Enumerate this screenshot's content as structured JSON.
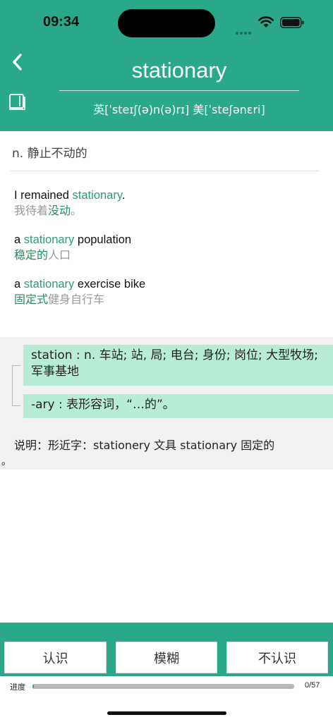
{
  "status": {
    "time": "09:34",
    "icons": [
      "signal-icon",
      "wifi-icon",
      "battery-icon"
    ]
  },
  "header": {
    "word": "stationary",
    "phonetics": "英[ˈsteɪʃ(ə)n(ə)rɪ]  美[ˈsteʃənɛri]",
    "icons": [
      "back-icon",
      "book-icon"
    ]
  },
  "definition": "n. 静止不动的",
  "examples": [
    {
      "en": [
        {
          "t": "I remained ",
          "h": false
        },
        {
          "t": "stationary",
          "h": true
        },
        {
          "t": ".",
          "h": false
        }
      ],
      "zh": [
        {
          "t": "我待着",
          "h": false
        },
        {
          "t": "没动",
          "h": true
        },
        {
          "t": "。",
          "h": false
        }
      ]
    },
    {
      "en": [
        {
          "t": "a ",
          "h": false
        },
        {
          "t": "stationary",
          "h": true
        },
        {
          "t": " population",
          "h": false
        }
      ],
      "zh": [
        {
          "t": "稳定的",
          "h": true
        },
        {
          "t": "人口",
          "h": false
        }
      ]
    },
    {
      "en": [
        {
          "t": "a ",
          "h": false
        },
        {
          "t": "stationary",
          "h": true
        },
        {
          "t": " exercise bike",
          "h": false
        }
      ],
      "zh": [
        {
          "t": "固定式",
          "h": true
        },
        {
          "t": "健身自行车",
          "h": false
        }
      ]
    }
  ],
  "etymology": {
    "roots": [
      "station : n. 车站; 站, 局; 电台; 身份; 岗位; 大型牧场; 军事基地",
      "-ary : 表形容词，“…的”。"
    ],
    "note": "说明：形近字：stationery 文具 stationary 固定的",
    "note_tail": "。"
  },
  "actions": {
    "know": "认识",
    "vague": "模糊",
    "unknown": "不认识"
  },
  "progress": {
    "label": "进度",
    "count": "0/57",
    "current": 0,
    "total": 57
  },
  "colors": {
    "primary": "#2aa98a",
    "highlight": "#2a9c77",
    "root_bg": "#b7edd5",
    "panel_bg": "#f1f1f1"
  }
}
